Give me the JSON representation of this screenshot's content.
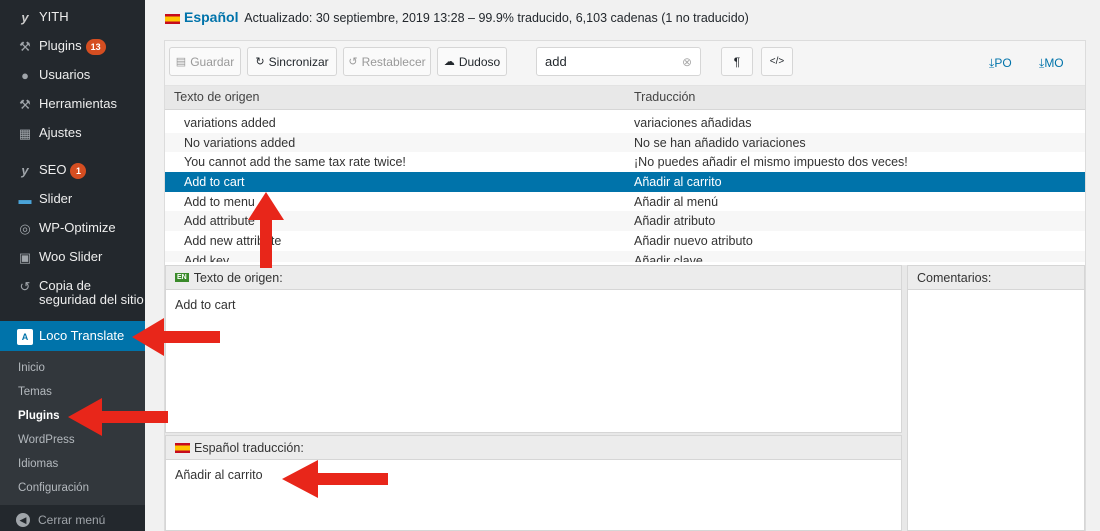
{
  "sidebar": {
    "items": [
      {
        "label": "YITH",
        "icon": "yith-icon"
      },
      {
        "label": "Plugins",
        "icon": "plugin-icon",
        "badge": "13"
      },
      {
        "label": "Usuarios",
        "icon": "users-icon"
      },
      {
        "label": "Herramientas",
        "icon": "wrench-icon"
      },
      {
        "label": "Ajustes",
        "icon": "settings-icon"
      },
      {
        "label": "SEO",
        "icon": "seo-icon",
        "badge": "1"
      },
      {
        "label": "Slider",
        "icon": "slider-icon"
      },
      {
        "label": "WP-Optimize",
        "icon": "optimize-icon"
      },
      {
        "label": "Woo Slider",
        "icon": "woo-slider-icon"
      },
      {
        "label_line1": "Copia de",
        "label_line2": "seguridad del sitio",
        "icon": "backup-icon"
      },
      {
        "label": "Loco Translate",
        "icon": "loco-translate-icon",
        "active": true
      }
    ],
    "submenu": [
      "Inicio",
      "Temas",
      "Plugins",
      "WordPress",
      "Idiomas",
      "Configuración"
    ],
    "submenu_current": "Plugins",
    "collapse_label": "Cerrar menú"
  },
  "header": {
    "language": "Español",
    "status": "Actualizado: 30 septiembre, 2019 13:28 – 99.9% traducido, 6,103 cadenas (1 no traducido)"
  },
  "toolbar": {
    "save": "Guardar",
    "sync": "Sincronizar",
    "revert": "Restablecer",
    "fuzzy": "Dudoso",
    "search_value": "add",
    "pilcrow": "¶",
    "code": "</>",
    "po": "PO",
    "mo": "MO"
  },
  "table": {
    "headers": [
      "Texto de origen",
      "Traducción"
    ],
    "rows": [
      [
        "variations added",
        "variaciones añadidas"
      ],
      [
        "No variations added",
        "No se han añadido variaciones"
      ],
      [
        "You cannot add the same tax rate twice!",
        "¡No puedes añadir el mismo impuesto dos veces!"
      ],
      [
        "Add to cart",
        "Añadir al carrito"
      ],
      [
        "Add to menu",
        "Añadir al menú"
      ],
      [
        "Add attribute",
        "Añadir atributo"
      ],
      [
        "Add new attribute",
        "Añadir nuevo atributo"
      ],
      [
        "Add key",
        "Añadir clave"
      ]
    ],
    "selected_row": 3
  },
  "source_pane": {
    "flag": "EN",
    "title": "Texto de origen:",
    "text": "Add to cart"
  },
  "translation_pane": {
    "title": "Español traducción:",
    "text": "Añadir al carrito"
  },
  "comments_pane": {
    "title": "Comentarios:"
  },
  "colors": {
    "sidebar": "#23282d",
    "active": "#0073aa",
    "badge": "#d54e21",
    "arrow": "#e8261a"
  }
}
